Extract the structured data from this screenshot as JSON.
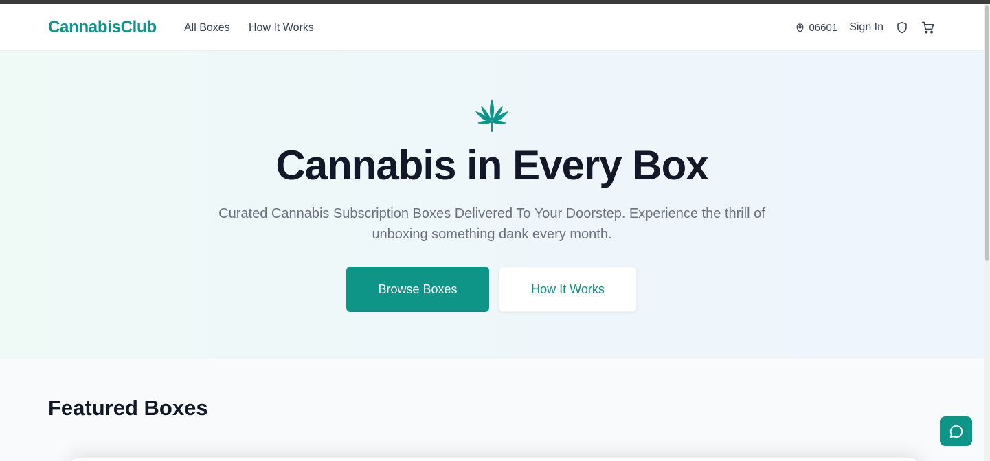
{
  "header": {
    "logo": "CannabisClub",
    "nav": [
      {
        "label": "All Boxes"
      },
      {
        "label": "How It Works"
      }
    ],
    "zip": "06601",
    "sign_in": "Sign In",
    "icons": [
      "location-pin-icon",
      "shield-icon",
      "cart-icon"
    ]
  },
  "hero": {
    "icon": "cannabis-leaf-icon",
    "title": "Cannabis in Every Box",
    "subtitle": "Curated Cannabis Subscription Boxes Delivered To Your Doorstep. Experience the thrill of unboxing something dank every month.",
    "primary_button": "Browse Boxes",
    "secondary_button": "How It Works"
  },
  "featured": {
    "heading": "Featured Boxes"
  },
  "chat": {
    "icon": "chat-bubble-icon"
  },
  "colors": {
    "brand": "#0d9488",
    "heading": "#111827",
    "body_text": "#6b7280"
  }
}
